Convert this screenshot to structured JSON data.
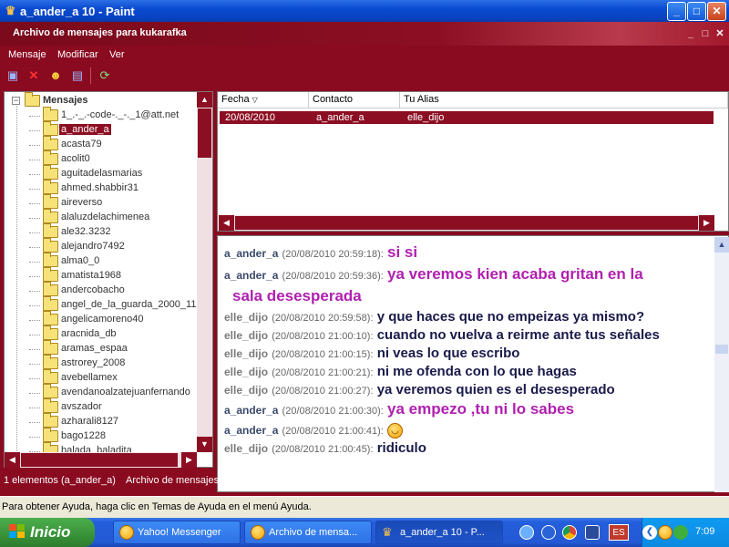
{
  "window": {
    "title": "a_ander_a 10 - Paint",
    "minimize": "_",
    "maximize": "□",
    "close": "✕"
  },
  "archive": {
    "title": "Archivo de mensajes para kukarafka",
    "menu": [
      "Mensaje",
      "Modificar",
      "Ver"
    ],
    "toolbar_icons": [
      "save-icon",
      "delete-icon",
      "users-icon",
      "print-icon",
      "refresh-icon"
    ]
  },
  "tree": {
    "root": "Mensajes",
    "items": [
      "1_.-_.-code-._-._1@att.net",
      "a_ander_a",
      "acasta79",
      "acolit0",
      "aguitadelasmarias",
      "ahmed.shabbir31",
      "aireverso",
      "alaluzdelachimenea",
      "ale32.3232",
      "alejandro7492",
      "alma0_0",
      "amatista1968",
      "andercobacho",
      "angel_de_la_guarda_2000_11",
      "angelicamoreno40",
      "aracnida_db",
      "aramas_espaa",
      "astrorey_2008",
      "avebellamex",
      "avendanoalzatejuanfernando",
      "avszador",
      "azharali8127",
      "bago1228",
      "balada_baladita"
    ],
    "selected_index": 1
  },
  "list": {
    "columns": [
      "Fecha",
      "Contacto",
      "Tu Alias"
    ],
    "rows": [
      {
        "fecha": "20/08/2010",
        "contacto": "a_ander_a",
        "alias": "elle_dijo"
      }
    ]
  },
  "chat": {
    "lines": [
      {
        "nick": "a_ander_a",
        "ts": "(20/08/2010 20:59:18):",
        "msg": "si si",
        "big": true
      },
      {
        "nick": "a_ander_a",
        "ts": "(20/08/2010 20:59:36):",
        "msg": "ya veremos kien acaba gritan en la",
        "big": true
      },
      {
        "cont": "sala desesperada"
      },
      {
        "nick": "elle_dijo",
        "ts": "(20/08/2010 20:59:58):",
        "msg": "y que haces que no empeizas ya mismo?"
      },
      {
        "nick": "elle_dijo",
        "ts": "(20/08/2010 21:00:10):",
        "msg": "cuando no vuelva a reirme ante tus señales"
      },
      {
        "nick": "elle_dijo",
        "ts": "(20/08/2010 21:00:15):",
        "msg": "ni veas lo que escribo"
      },
      {
        "nick": "elle_dijo",
        "ts": "(20/08/2010 21:00:21):",
        "msg": "ni me ofenda con lo que hagas"
      },
      {
        "nick": "elle_dijo",
        "ts": "(20/08/2010 21:00:27):",
        "msg": "ya veremos quien es el desesperado"
      },
      {
        "nick": "a_ander_a",
        "ts": "(20/08/2010 21:00:30):",
        "msg": "ya empezo ,tu ni lo sabes",
        "big": true
      },
      {
        "nick": "a_ander_a",
        "ts": "(20/08/2010 21:00:41):",
        "msg": "",
        "smiley": true
      },
      {
        "nick": "elle_dijo",
        "ts": "(20/08/2010 21:00:45):",
        "msg": "ridiculo"
      }
    ]
  },
  "status": {
    "count": "1 elementos (a_ander_a)",
    "archive": "Archivo de mensajes: Activado"
  },
  "paint_status": "Para obtener Ayuda, haga clic en Temas de Ayuda en el menú Ayuda.",
  "taskbar": {
    "start": "Inicio",
    "tasks": [
      "Yahoo! Messenger",
      "Archivo de mensa...",
      "a_ander_a 10 - P..."
    ],
    "lang": "ES",
    "clock": "7:09"
  }
}
